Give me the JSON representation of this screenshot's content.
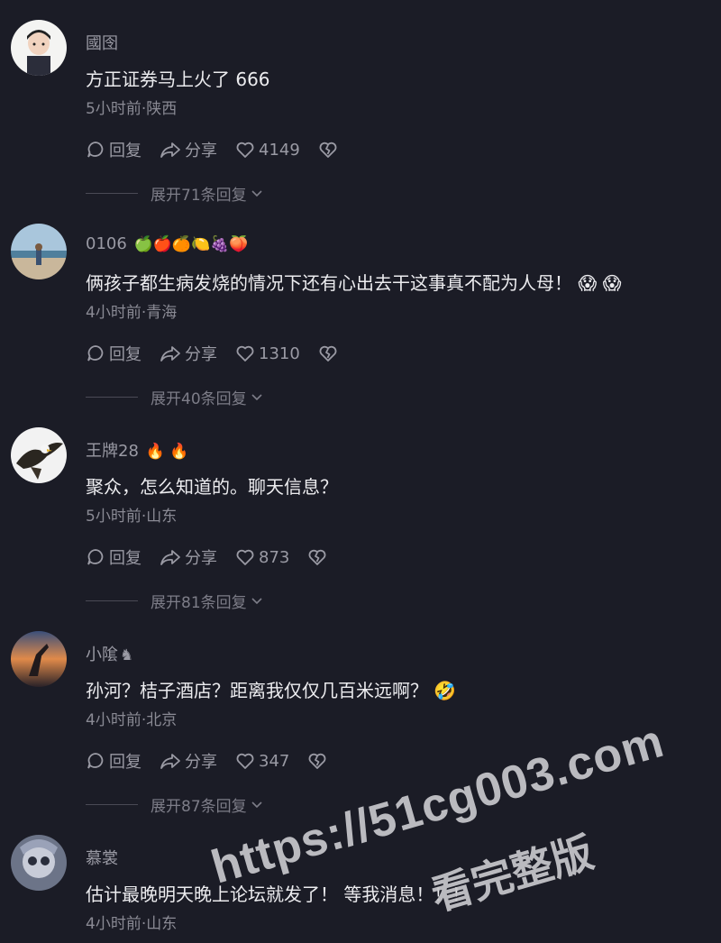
{
  "comments": [
    {
      "username": "國囹",
      "emojis": "",
      "text": "方正证券马上火了 666",
      "meta": "5小时前·陕西",
      "reply_label": "回复",
      "share_label": "分享",
      "likes": "4149",
      "expand_label": "展开71条回复"
    },
    {
      "username": "0106",
      "emojis": "🍏🍎🍊🍋🍇🍑",
      "text": "俩孩子都生病发烧的情况下还有心出去干这事真不配为人母！ 😱 😱",
      "meta": "4小时前·青海",
      "reply_label": "回复",
      "share_label": "分享",
      "likes": "1310",
      "expand_label": "展开40条回复"
    },
    {
      "username": "王牌28",
      "emojis": "🔥 🔥",
      "text": "聚众，怎么知道的。聊天信息？",
      "meta": "5小时前·山东",
      "reply_label": "回复",
      "share_label": "分享",
      "likes": "873",
      "expand_label": "展开81条回复"
    },
    {
      "username": "小隂",
      "emojis": "♞",
      "text": "孙河？桔子酒店？距离我仅仅几百米远啊？ 🤣",
      "meta": "4小时前·北京",
      "reply_label": "回复",
      "share_label": "分享",
      "likes": "347",
      "expand_label": "展开87条回复"
    },
    {
      "username": "慕裳",
      "emojis": "",
      "text": "估计最晚明天晚上论坛就发了！ 等我消息！！！",
      "meta": "4小时前·山东",
      "reply_label": "",
      "share_label": "",
      "likes": "",
      "expand_label": ""
    }
  ],
  "watermark": {
    "url": "https://51cg003.com",
    "caption": "看完整版"
  },
  "colors": {
    "background": "#1b1c26",
    "text": "#ececef",
    "muted": "#8a8a94"
  }
}
